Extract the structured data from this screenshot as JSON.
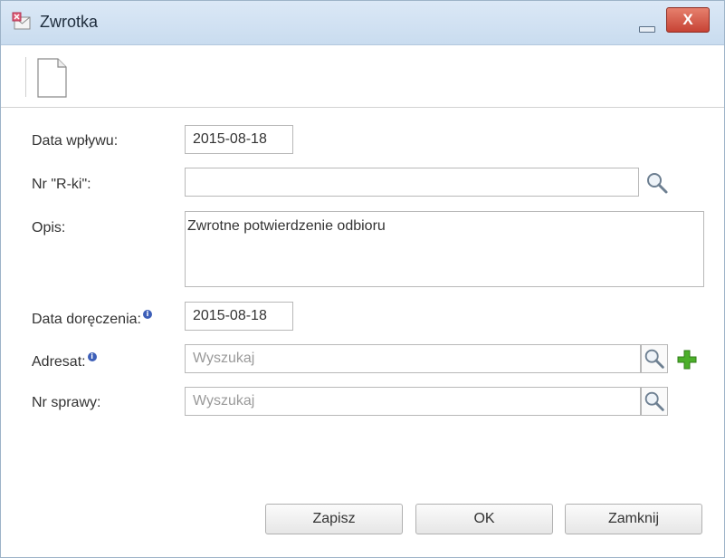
{
  "window": {
    "title": "Zwrotka",
    "close_label": "X"
  },
  "toolbar": {
    "new_document_icon": "blank-document-icon"
  },
  "form": {
    "data_wplywu": {
      "label": "Data wpływu:",
      "value": "2015-08-18"
    },
    "nr_rki": {
      "label": "Nr \"R-ki\":",
      "value": ""
    },
    "opis": {
      "label": "Opis:",
      "value": "Zwrotne potwierdzenie odbioru"
    },
    "data_doreczenia": {
      "label": "Data doręczenia:",
      "value": "2015-08-18"
    },
    "adresat": {
      "label": "Adresat:",
      "placeholder": "Wyszukaj"
    },
    "nr_sprawy": {
      "label": "Nr sprawy:",
      "placeholder": "Wyszukaj"
    }
  },
  "buttons": {
    "save": "Zapisz",
    "ok": "OK",
    "close": "Zamknij"
  },
  "colors": {
    "titlebar": "#c9dcef",
    "close_button": "#c74335",
    "info_icon": "#3d5fb8",
    "add_icon": "#4caf2a"
  }
}
